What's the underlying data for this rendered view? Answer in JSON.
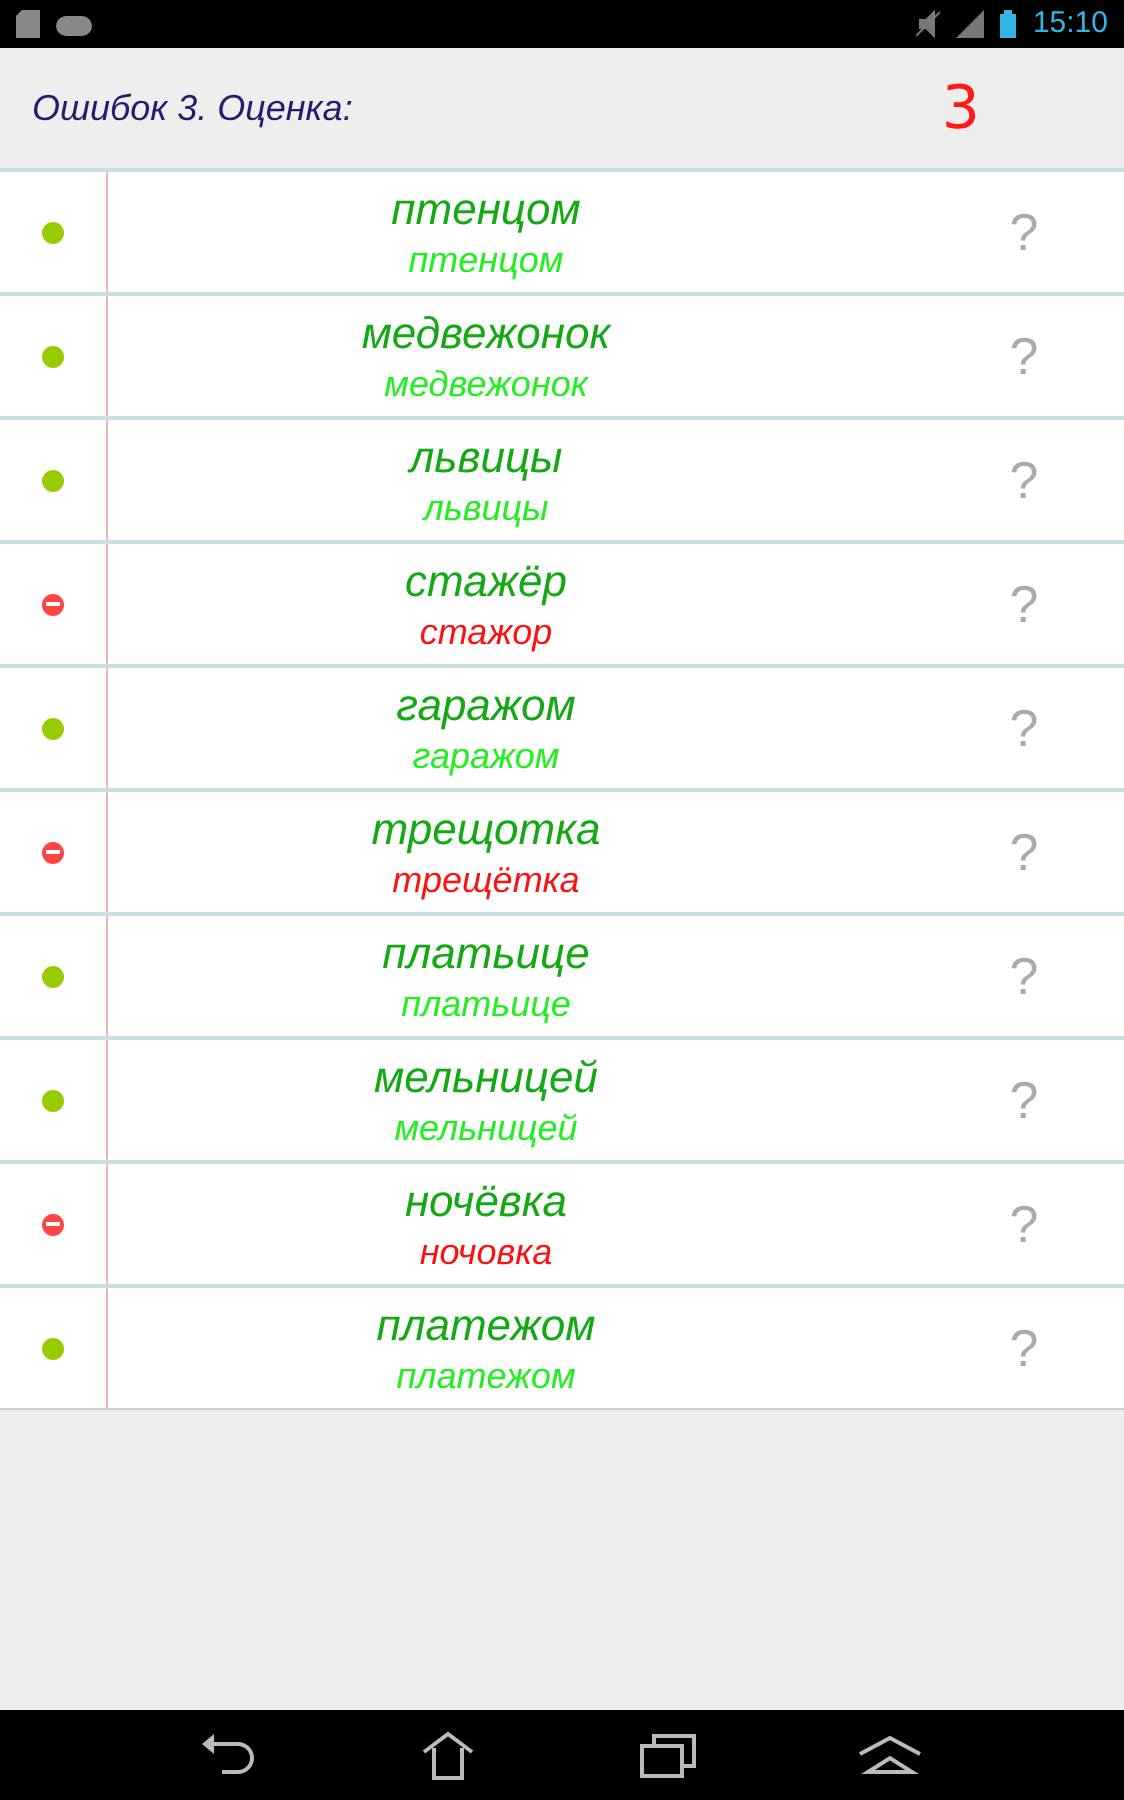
{
  "status_bar": {
    "time": "15:10"
  },
  "header": {
    "summary": "Ошибок 3. Оценка:",
    "grade": "3"
  },
  "rows": [
    {
      "word": "птенцом",
      "answer": "птенцом",
      "correct": true,
      "hint": "?"
    },
    {
      "word": "медвежонок",
      "answer": "медвежонок",
      "correct": true,
      "hint": "?"
    },
    {
      "word": "львицы",
      "answer": "львицы",
      "correct": true,
      "hint": "?"
    },
    {
      "word": "стажёр",
      "answer": "стажор",
      "correct": false,
      "hint": "?"
    },
    {
      "word": "гаражом",
      "answer": "гаражом",
      "correct": true,
      "hint": "?"
    },
    {
      "word": "трещотка",
      "answer": "трещётка",
      "correct": false,
      "hint": "?"
    },
    {
      "word": "платьице",
      "answer": "платьице",
      "correct": true,
      "hint": "?"
    },
    {
      "word": "мельницей",
      "answer": "мельницей",
      "correct": true,
      "hint": "?"
    },
    {
      "word": "ночёвка",
      "answer": "ночовка",
      "correct": false,
      "hint": "?"
    },
    {
      "word": "платежом",
      "answer": "платежом",
      "correct": true,
      "hint": "?"
    }
  ]
}
